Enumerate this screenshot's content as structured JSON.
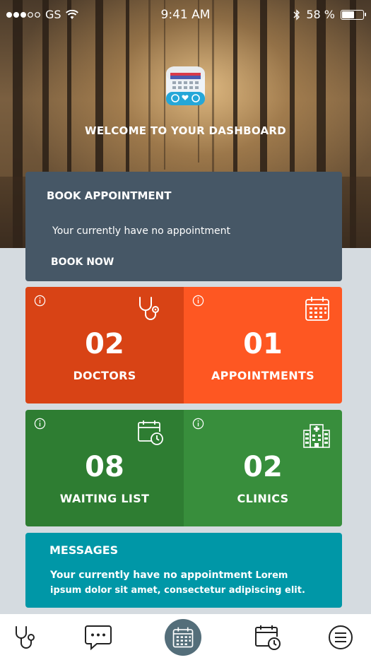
{
  "status_bar": {
    "carrier": "GS",
    "time": "9:41 AM",
    "battery_text": "58 %",
    "battery_level": 0.58
  },
  "header": {
    "app_icon": "calendar-medical-app-icon",
    "welcome": "WELCOME TO YOUR DASHBOARD"
  },
  "book_card": {
    "title": "BOOK APPOINTMENT",
    "message": "Your currently have no appointment",
    "button": "BOOK NOW"
  },
  "tiles": [
    {
      "number": "02",
      "label": "DOCTORS",
      "icon": "stethoscope-icon",
      "color": "#d84315"
    },
    {
      "number": "01",
      "label": "APPOINTMENTS",
      "icon": "calendar-grid-icon",
      "color": "#fe5722"
    },
    {
      "number": "08",
      "label": "WAITING LIST",
      "icon": "calendar-clock-icon",
      "color": "#2e7d32"
    },
    {
      "number": "02",
      "label": "CLINICS",
      "icon": "hospital-building-icon",
      "color": "#388e3c"
    }
  ],
  "messages": {
    "title": "MESSAGES",
    "body_lead": "Your currently have no appointment",
    "body_rest": " Lorem ipsum dolor sit amet, consectetur adipiscing elit.",
    "color": "#0097a7"
  },
  "tab_bar": {
    "items": [
      "stethoscope-icon",
      "chat-icon",
      "calendar-grid-icon",
      "calendar-clock-icon",
      "menu-icon"
    ],
    "active": 2,
    "active_color": "#546e7a"
  }
}
